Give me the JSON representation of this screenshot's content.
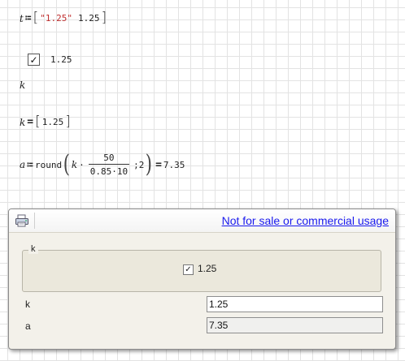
{
  "worksheet": {
    "line1": {
      "var": "t",
      "assign": "≔",
      "open_bracket": "[",
      "string_value": "\"1.25\"",
      "number_value": "1.25",
      "close_bracket": "]"
    },
    "checkbox_widget": {
      "checked": true,
      "check_glyph": "✓",
      "value": "1.25"
    },
    "line_k_label": "k",
    "line_k": {
      "var": "k",
      "equals": "=",
      "open_bracket": "[",
      "value": "1.25",
      "close_bracket": "]"
    },
    "line_a": {
      "var": "a",
      "assign": "≔",
      "func": "round",
      "open_paren": "(",
      "k": "k",
      "dot": "·",
      "numerator": "50",
      "denominator": "0.85·10",
      "args_sep": ";",
      "digits": "2",
      "close_paren": ")",
      "equals": "=",
      "result": "7.35"
    }
  },
  "panel": {
    "print_icon": "printer-icon",
    "notice_link": "Not for sale or commercial usage",
    "group_label": "k",
    "checkbox_checked": true,
    "checkbox_glyph": "✓",
    "checkbox_label": "1.25",
    "fields": {
      "k_label": "k",
      "k_value": "1.25",
      "a_label": "a",
      "a_value": "7.35"
    }
  }
}
